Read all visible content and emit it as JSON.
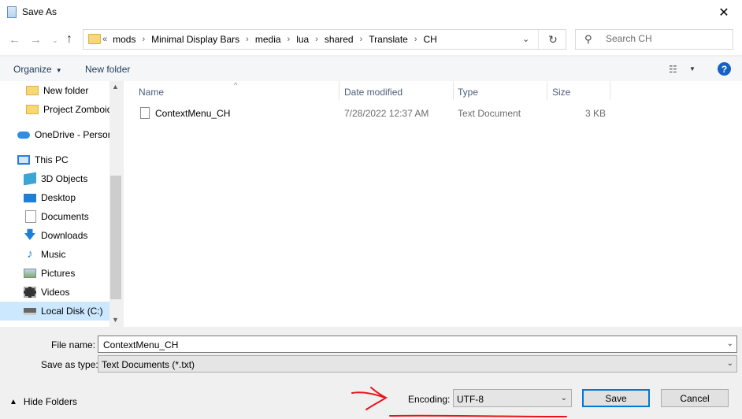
{
  "window": {
    "title": "Save As",
    "close_glyph": "✕"
  },
  "nav": {
    "back_glyph": "←",
    "forward_glyph": "→",
    "history_glyph": "⌄",
    "up_glyph": "↑",
    "breadcrumb_prefix": "«",
    "breadcrumbs": [
      "mods",
      "Minimal Display Bars",
      "media",
      "lua",
      "shared",
      "Translate",
      "CH"
    ],
    "separator": "›",
    "dropdown_glyph": "⌄",
    "refresh_glyph": "↻"
  },
  "search": {
    "placeholder": "Search CH",
    "icon_glyph": "⚲"
  },
  "toolbar": {
    "organize_label": "Organize",
    "organize_caret": "▼",
    "new_folder_label": "New folder",
    "view_glyph": "☷",
    "view_caret": "▼",
    "help_glyph": "?"
  },
  "sidebar": {
    "items": [
      {
        "label": "New folder",
        "icon": "folder-icon"
      },
      {
        "label": "Project Zomboid",
        "icon": "folder-icon"
      },
      {
        "label": "OneDrive - Personal",
        "icon": "cloud-icon"
      },
      {
        "label": "This PC",
        "icon": "computer-icon"
      },
      {
        "label": "3D Objects",
        "icon": "cube-icon"
      },
      {
        "label": "Desktop",
        "icon": "desktop-icon"
      },
      {
        "label": "Documents",
        "icon": "documents-icon"
      },
      {
        "label": "Downloads",
        "icon": "download-icon",
        "glyph": "🡇"
      },
      {
        "label": "Music",
        "icon": "music-icon",
        "glyph": "♪"
      },
      {
        "label": "Pictures",
        "icon": "pictures-icon"
      },
      {
        "label": "Videos",
        "icon": "video-icon"
      },
      {
        "label": "Local Disk (C:)",
        "icon": "disk-icon",
        "selected": true
      }
    ],
    "scroll_up_glyph": "▲",
    "scroll_down_glyph": "▼"
  },
  "file_list": {
    "columns": [
      "Name",
      "Date modified",
      "Type",
      "Size"
    ],
    "sort_glyph": "^",
    "rows": [
      {
        "name": "ContextMenu_CH",
        "date": "7/28/2022 12:37 AM",
        "type": "Text Document",
        "size": "3 KB"
      }
    ]
  },
  "form": {
    "filename_label": "File name:",
    "filename_value": "ContextMenu_CH",
    "savetype_label": "Save as type:",
    "savetype_value": "Text Documents (*.txt)",
    "dropdown_glyph": "⌄",
    "encoding_label": "Encoding:",
    "encoding_value": "UTF-8"
  },
  "footer": {
    "hide_folders_label": "Hide Folders",
    "hide_glyph": "▲",
    "save_label": "Save",
    "cancel_label": "Cancel"
  },
  "colors": {
    "accent": "#0078d7",
    "selection": "#cce8ff",
    "annotation": "#e8141b",
    "help": "#1561c1"
  }
}
